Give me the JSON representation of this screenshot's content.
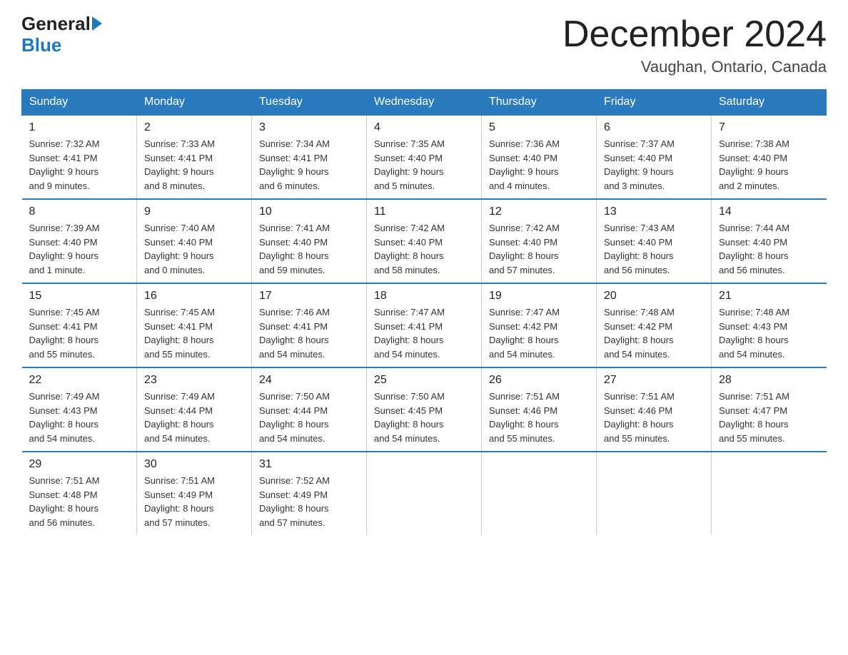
{
  "logo": {
    "general": "General",
    "arrow": "▶",
    "blue": "Blue"
  },
  "title": "December 2024",
  "subtitle": "Vaughan, Ontario, Canada",
  "days_of_week": [
    "Sunday",
    "Monday",
    "Tuesday",
    "Wednesday",
    "Thursday",
    "Friday",
    "Saturday"
  ],
  "weeks": [
    [
      {
        "day": "1",
        "sunrise": "7:32 AM",
        "sunset": "4:41 PM",
        "daylight": "9 hours and 9 minutes."
      },
      {
        "day": "2",
        "sunrise": "7:33 AM",
        "sunset": "4:41 PM",
        "daylight": "9 hours and 8 minutes."
      },
      {
        "day": "3",
        "sunrise": "7:34 AM",
        "sunset": "4:41 PM",
        "daylight": "9 hours and 6 minutes."
      },
      {
        "day": "4",
        "sunrise": "7:35 AM",
        "sunset": "4:40 PM",
        "daylight": "9 hours and 5 minutes."
      },
      {
        "day": "5",
        "sunrise": "7:36 AM",
        "sunset": "4:40 PM",
        "daylight": "9 hours and 4 minutes."
      },
      {
        "day": "6",
        "sunrise": "7:37 AM",
        "sunset": "4:40 PM",
        "daylight": "9 hours and 3 minutes."
      },
      {
        "day": "7",
        "sunrise": "7:38 AM",
        "sunset": "4:40 PM",
        "daylight": "9 hours and 2 minutes."
      }
    ],
    [
      {
        "day": "8",
        "sunrise": "7:39 AM",
        "sunset": "4:40 PM",
        "daylight": "9 hours and 1 minute."
      },
      {
        "day": "9",
        "sunrise": "7:40 AM",
        "sunset": "4:40 PM",
        "daylight": "9 hours and 0 minutes."
      },
      {
        "day": "10",
        "sunrise": "7:41 AM",
        "sunset": "4:40 PM",
        "daylight": "8 hours and 59 minutes."
      },
      {
        "day": "11",
        "sunrise": "7:42 AM",
        "sunset": "4:40 PM",
        "daylight": "8 hours and 58 minutes."
      },
      {
        "day": "12",
        "sunrise": "7:42 AM",
        "sunset": "4:40 PM",
        "daylight": "8 hours and 57 minutes."
      },
      {
        "day": "13",
        "sunrise": "7:43 AM",
        "sunset": "4:40 PM",
        "daylight": "8 hours and 56 minutes."
      },
      {
        "day": "14",
        "sunrise": "7:44 AM",
        "sunset": "4:40 PM",
        "daylight": "8 hours and 56 minutes."
      }
    ],
    [
      {
        "day": "15",
        "sunrise": "7:45 AM",
        "sunset": "4:41 PM",
        "daylight": "8 hours and 55 minutes."
      },
      {
        "day": "16",
        "sunrise": "7:45 AM",
        "sunset": "4:41 PM",
        "daylight": "8 hours and 55 minutes."
      },
      {
        "day": "17",
        "sunrise": "7:46 AM",
        "sunset": "4:41 PM",
        "daylight": "8 hours and 54 minutes."
      },
      {
        "day": "18",
        "sunrise": "7:47 AM",
        "sunset": "4:41 PM",
        "daylight": "8 hours and 54 minutes."
      },
      {
        "day": "19",
        "sunrise": "7:47 AM",
        "sunset": "4:42 PM",
        "daylight": "8 hours and 54 minutes."
      },
      {
        "day": "20",
        "sunrise": "7:48 AM",
        "sunset": "4:42 PM",
        "daylight": "8 hours and 54 minutes."
      },
      {
        "day": "21",
        "sunrise": "7:48 AM",
        "sunset": "4:43 PM",
        "daylight": "8 hours and 54 minutes."
      }
    ],
    [
      {
        "day": "22",
        "sunrise": "7:49 AM",
        "sunset": "4:43 PM",
        "daylight": "8 hours and 54 minutes."
      },
      {
        "day": "23",
        "sunrise": "7:49 AM",
        "sunset": "4:44 PM",
        "daylight": "8 hours and 54 minutes."
      },
      {
        "day": "24",
        "sunrise": "7:50 AM",
        "sunset": "4:44 PM",
        "daylight": "8 hours and 54 minutes."
      },
      {
        "day": "25",
        "sunrise": "7:50 AM",
        "sunset": "4:45 PM",
        "daylight": "8 hours and 54 minutes."
      },
      {
        "day": "26",
        "sunrise": "7:51 AM",
        "sunset": "4:46 PM",
        "daylight": "8 hours and 55 minutes."
      },
      {
        "day": "27",
        "sunrise": "7:51 AM",
        "sunset": "4:46 PM",
        "daylight": "8 hours and 55 minutes."
      },
      {
        "day": "28",
        "sunrise": "7:51 AM",
        "sunset": "4:47 PM",
        "daylight": "8 hours and 55 minutes."
      }
    ],
    [
      {
        "day": "29",
        "sunrise": "7:51 AM",
        "sunset": "4:48 PM",
        "daylight": "8 hours and 56 minutes."
      },
      {
        "day": "30",
        "sunrise": "7:51 AM",
        "sunset": "4:49 PM",
        "daylight": "8 hours and 57 minutes."
      },
      {
        "day": "31",
        "sunrise": "7:52 AM",
        "sunset": "4:49 PM",
        "daylight": "8 hours and 57 minutes."
      },
      null,
      null,
      null,
      null
    ]
  ],
  "labels": {
    "sunrise": "Sunrise:",
    "sunset": "Sunset:",
    "daylight": "Daylight:"
  }
}
